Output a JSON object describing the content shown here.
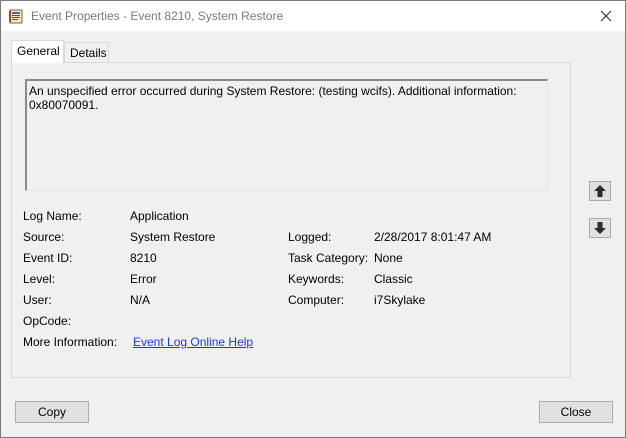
{
  "window": {
    "title": "Event Properties - Event 8210, System Restore"
  },
  "tabs": [
    {
      "label": "General",
      "active": true
    },
    {
      "label": "Details",
      "active": false
    }
  ],
  "description": "An unspecified error occurred during System Restore: (testing wcifs). Additional information: 0x80070091.",
  "fields": {
    "log_name": {
      "label": "Log Name:",
      "value": "Application"
    },
    "source": {
      "label": "Source:",
      "value": "System Restore"
    },
    "logged": {
      "label": "Logged:",
      "value": "2/28/2017 8:01:47 AM"
    },
    "event_id": {
      "label": "Event ID:",
      "value": "8210"
    },
    "task_category": {
      "label": "Task Category:",
      "value": "None"
    },
    "level": {
      "label": "Level:",
      "value": "Error"
    },
    "keywords": {
      "label": "Keywords:",
      "value": "Classic"
    },
    "user": {
      "label": "User:",
      "value": "N/A"
    },
    "computer": {
      "label": "Computer:",
      "value": "i7Skylake"
    },
    "opcode": {
      "label": "OpCode:",
      "value": ""
    },
    "more_info": {
      "label": "More Information:",
      "link": "Event Log Online Help"
    }
  },
  "buttons": {
    "copy": "Copy",
    "close": "Close"
  },
  "icons": {
    "close": "close-icon",
    "up": "arrow-up-icon",
    "down": "arrow-down-icon",
    "app": "event-viewer-icon"
  },
  "colors": {
    "link": "#1a3fcf",
    "title_text": "#7a7a7a"
  }
}
